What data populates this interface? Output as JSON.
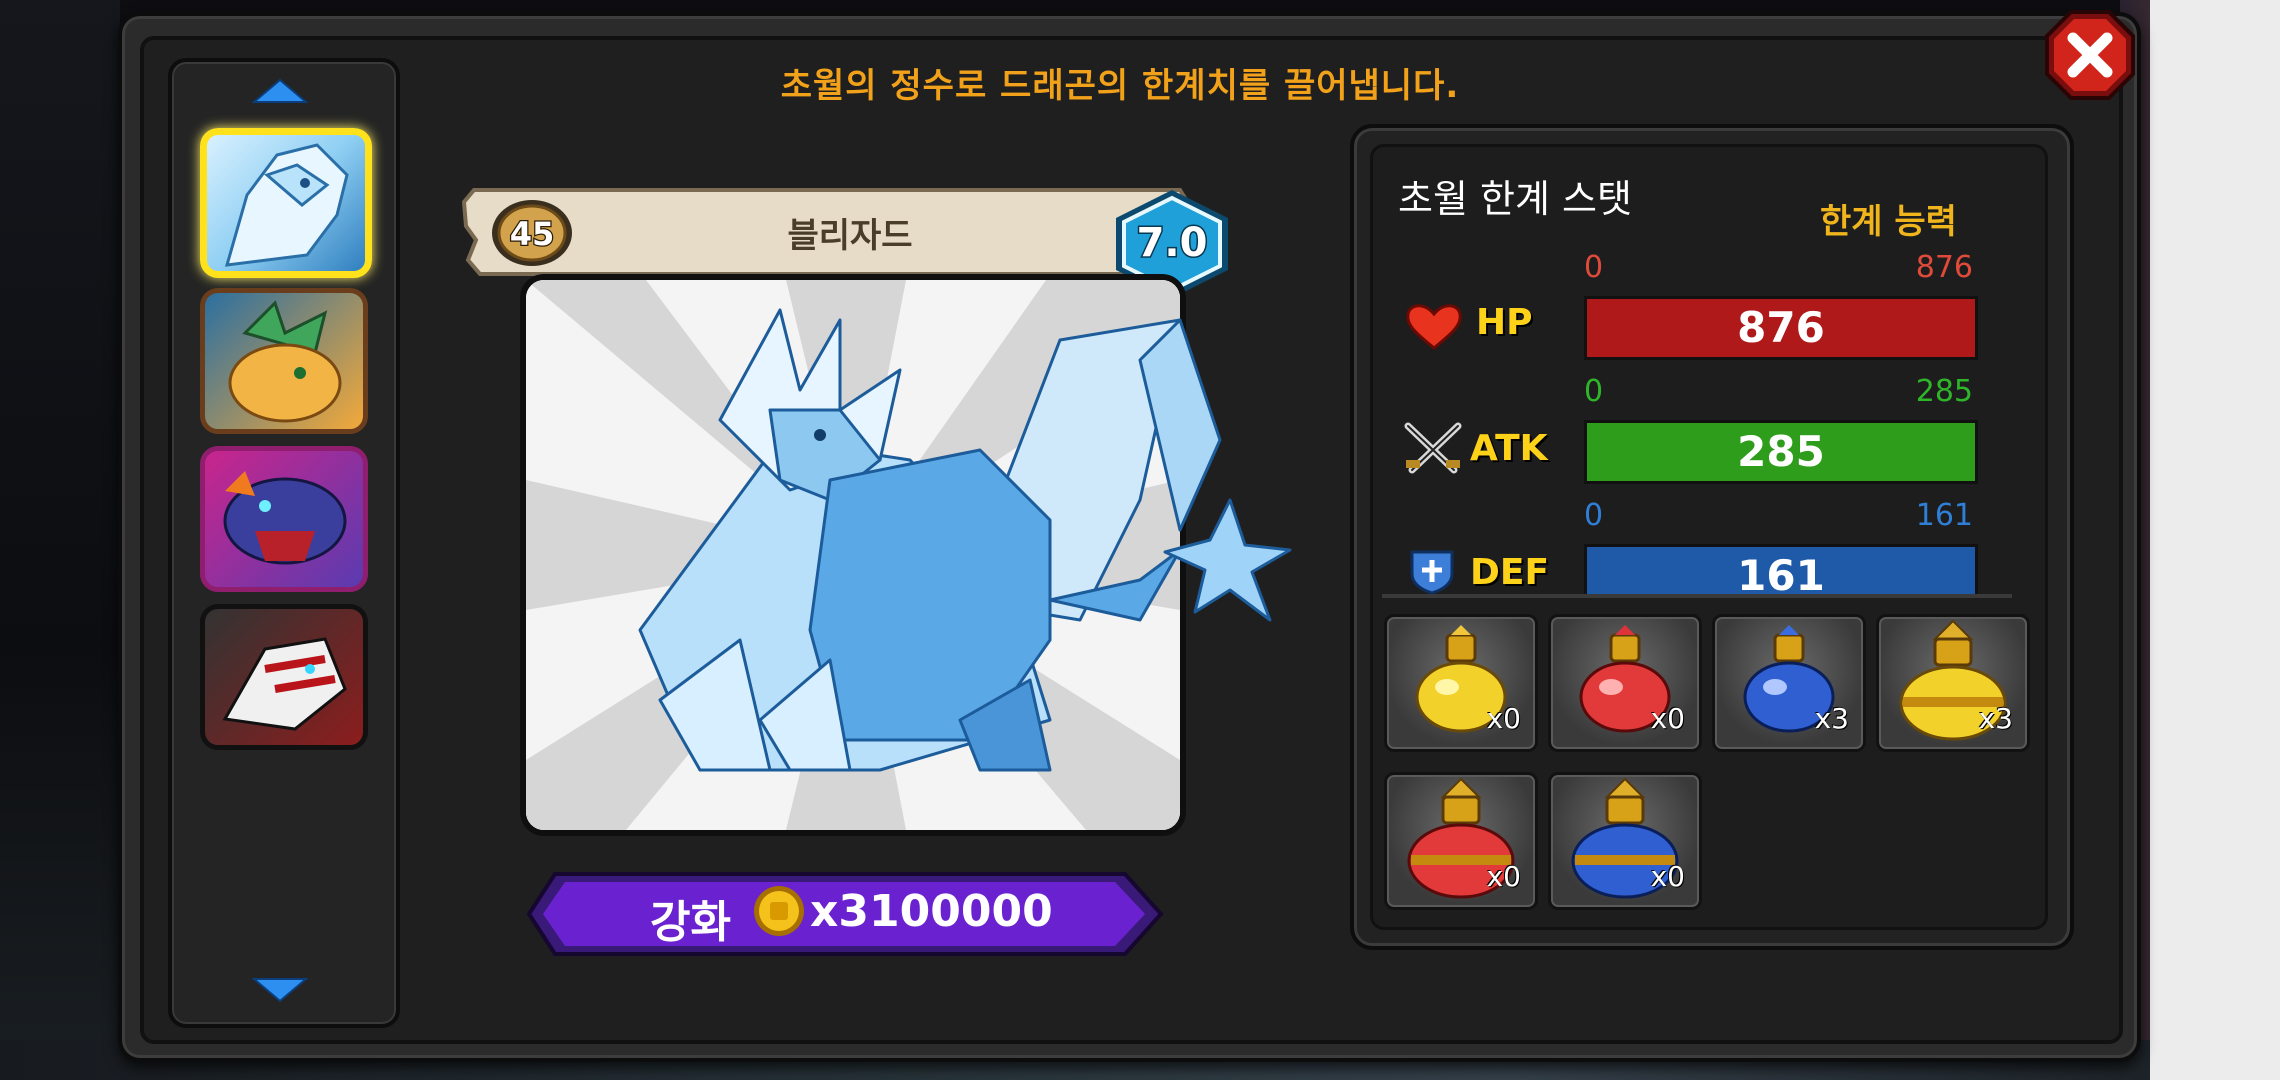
{
  "header": {
    "subtitle": "초월의 정수로 드래곤의 한계치를 끌어냅니다."
  },
  "dragon": {
    "name": "블리자드",
    "level": "45",
    "grade": "7.0"
  },
  "enhance": {
    "label": "강화",
    "cost": "x3100000"
  },
  "stats": {
    "title": "초월 한계 스탯",
    "limit_label": "한계 능력",
    "rows": [
      {
        "name": "HP",
        "min": "0",
        "max": "876",
        "value": "876",
        "color": "#b0191a",
        "text_color": "#e04a3a"
      },
      {
        "name": "ATK",
        "min": "0",
        "max": "285",
        "value": "285",
        "color": "#2f9d1c",
        "text_color": "#2fb52a"
      },
      {
        "name": "DEF",
        "min": "0",
        "max": "161",
        "value": "161",
        "color": "#1e5aa8",
        "text_color": "#2f7fd6"
      }
    ]
  },
  "items": [
    {
      "icon": "yellow-potion-icon",
      "count": "x0"
    },
    {
      "icon": "red-potion-icon",
      "count": "x0"
    },
    {
      "icon": "blue-potion-icon",
      "count": "x3"
    },
    {
      "icon": "large-yellow-potion-icon",
      "count": "x3"
    },
    {
      "icon": "large-red-potion-icon",
      "count": "x0"
    },
    {
      "icon": "large-blue-potion-icon",
      "count": "x0"
    }
  ],
  "dragon_list": [
    {
      "icon": "ice-dragon-icon",
      "selected": true
    },
    {
      "icon": "leaf-dragon-icon",
      "selected": false
    },
    {
      "icon": "dark-dragon-icon",
      "selected": false
    },
    {
      "icon": "white-red-dragon-icon",
      "selected": false
    }
  ]
}
